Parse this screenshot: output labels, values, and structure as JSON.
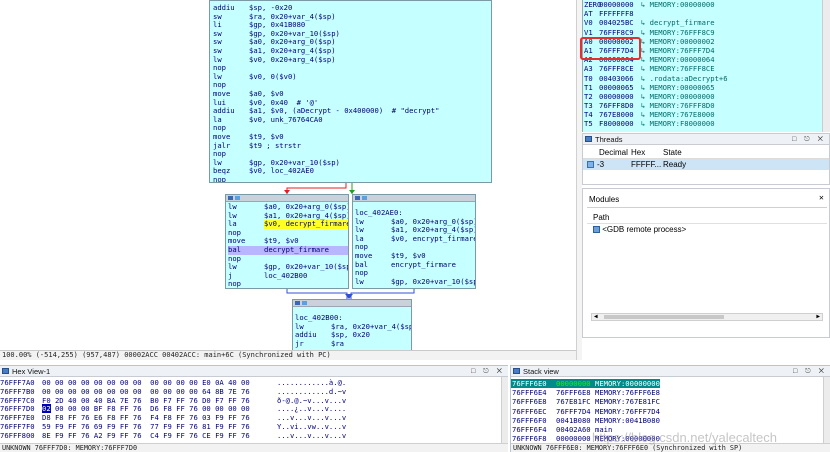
{
  "graph": {
    "top_block": [
      {
        "m": "addiu",
        "o": "$sp, -0x20"
      },
      {
        "m": "sw",
        "o": "$ra, 0x20+var_4($sp)"
      },
      {
        "m": "li",
        "o": "$gp, 0x41B080"
      },
      {
        "m": "sw",
        "o": "$gp, 0x20+var_10($sp)"
      },
      {
        "m": "sw",
        "o": "$a0, 0x20+arg_0($sp)"
      },
      {
        "m": "sw",
        "o": "$a1, 0x20+arg_4($sp)"
      },
      {
        "m": "lw",
        "o": "$v0, 0x20+arg_4($sp)"
      },
      {
        "m": "nop",
        "o": ""
      },
      {
        "m": "lw",
        "o": "$v0, 0($v0)"
      },
      {
        "m": "nop",
        "o": ""
      },
      {
        "m": "move",
        "o": "$a0, $v0"
      },
      {
        "m": "lui",
        "o": "$v0, 0x40  # '@'"
      },
      {
        "m": "addiu",
        "o": "$a1, $v0, (aDecrypt - 0x400000)  # \"decrypt\""
      },
      {
        "m": "la",
        "o": "$v0, unk_76764CA0"
      },
      {
        "m": "nop",
        "o": ""
      },
      {
        "m": "move",
        "o": "$t9, $v0"
      },
      {
        "m": "jalr",
        "o": "$t9 ; strstr"
      },
      {
        "m": "nop",
        "o": ""
      },
      {
        "m": "lw",
        "o": "$gp, 0x20+var_10($sp)"
      },
      {
        "m": "beqz",
        "o": "$v0, loc_402AE0"
      },
      {
        "m": "nop",
        "o": ""
      }
    ],
    "left_block": [
      {
        "m": "lw",
        "o": "$a0, 0x20+arg_0($sp)"
      },
      {
        "m": "lw",
        "o": "$a1, 0x20+arg_4($sp)"
      },
      {
        "m": "la",
        "o": "$v0, decrypt_firmare"
      },
      {
        "m": "nop",
        "o": ""
      },
      {
        "m": "move",
        "o": "$t9, $v0"
      },
      {
        "m": "bal",
        "o": "decrypt_firmare"
      },
      {
        "m": "nop",
        "o": ""
      },
      {
        "m": "lw",
        "o": "$gp, 0x20+var_10($sp)"
      },
      {
        "m": "j",
        "o": "loc_402B00"
      },
      {
        "m": "nop",
        "o": ""
      }
    ],
    "right_label": "loc_402AE0:",
    "right_block": [
      {
        "m": "lw",
        "o": "$a0, 0x20+arg_0($sp)"
      },
      {
        "m": "lw",
        "o": "$a1, 0x20+arg_4($sp)"
      },
      {
        "m": "la",
        "o": "$v0, encrypt_firmare"
      },
      {
        "m": "nop",
        "o": ""
      },
      {
        "m": "move",
        "o": "$t9, $v0"
      },
      {
        "m": "bal",
        "o": "encrypt_firmare"
      },
      {
        "m": "nop",
        "o": ""
      },
      {
        "m": "lw",
        "o": "$gp, 0x20+var_10($sp)"
      }
    ],
    "bottom_label": "loc_402B00:",
    "bottom_block": [
      {
        "m": "lw",
        "o": "$ra, 0x20+var_4($sp)"
      },
      {
        "m": "addiu",
        "o": "$sp, 0x20"
      },
      {
        "m": "jr",
        "o": "$ra"
      },
      {
        "m": "nop",
        "o": ""
      }
    ],
    "coord_status": "100.00% (-514,255) (957,487) 00002ACC 00402ACC: main+6C (Synchronized with PC)"
  },
  "registers": [
    {
      "name": "ZERO",
      "value": "00000000",
      "desc": "MEMORY:00000000"
    },
    {
      "name": "AT",
      "value": "FFFFFFF8",
      "desc": ""
    },
    {
      "name": "V0",
      "value": "004025BC",
      "desc": "decrypt_firmare"
    },
    {
      "name": "V1",
      "value": "76FFF8C9",
      "desc": "MEMORY:76FFF8C9"
    },
    {
      "name": "A0",
      "value": "00000002",
      "desc": "MEMORY:00000002"
    },
    {
      "name": "A1",
      "value": "76FFF7D4",
      "desc": "MEMORY:76FFF7D4"
    },
    {
      "name": "A2",
      "value": "00000064",
      "desc": "MEMORY:00000064"
    },
    {
      "name": "A3",
      "value": "76FFF8CE",
      "desc": "MEMORY:76FFF8CE"
    },
    {
      "name": "T0",
      "value": "00403066",
      "desc": ".rodata:aDecrypt+6"
    },
    {
      "name": "T1",
      "value": "00000065",
      "desc": "MEMORY:00000065"
    },
    {
      "name": "T2",
      "value": "00000000",
      "desc": "MEMORY:00000000"
    },
    {
      "name": "T3",
      "value": "76FFF8D0",
      "desc": "MEMORY:76FFF8D0"
    },
    {
      "name": "T4",
      "value": "767E8000",
      "desc": "MEMORY:767E8000"
    },
    {
      "name": "T5",
      "value": "F8000000",
      "desc": "MEMORY:F8000000"
    }
  ],
  "threads": {
    "title": "Threads",
    "columns": [
      "Decimal",
      "Hex",
      "State"
    ],
    "rows": [
      {
        "decimal": "-3",
        "hex": "FFFFF...",
        "state": "Ready"
      }
    ]
  },
  "modules": {
    "title": "Modules",
    "column": "Path",
    "rows": [
      "<GDB remote process>"
    ]
  },
  "hex_view": {
    "title": "Hex View-1",
    "rows": [
      {
        "addr": "76FFF7A0",
        "bytes": "00 00 00 00 00 00 00 00  00 00 00 00 E0 0A 40 00",
        "ascii": "............à.@."
      },
      {
        "addr": "76FFF7B0",
        "bytes": "00 00 00 00 00 00 00 00  00 00 00 00 64 8B 7E 76",
        "ascii": "............d.~v"
      },
      {
        "addr": "76FFF7C0",
        "bytes": "F0 2D 40 00 40 BA 7E 76  B0 F7 FF 76 D0 F7 FF 76",
        "ascii": "ð-@.@.~v...v...v"
      },
      {
        "addr": "76FFF7D0",
        "bytes": "02 00 00 00 BF F8 FF 76  D6 F8 FF 76 00 00 00 00",
        "ascii": "....¿..v...v...."
      },
      {
        "addr": "76FFF7E0",
        "bytes": "D8 F8 FF 76 E6 F8 FF 76  F4 F8 FF 76 03 F9 FF 76",
        "ascii": "...v...v...v...v"
      },
      {
        "addr": "76FFF7F0",
        "bytes": "59 F9 FF 76 69 F9 FF 76  77 F9 FF 76 81 F9 FF 76",
        "ascii": "Y..vi..vw..v...v"
      },
      {
        "addr": "76FFF800",
        "bytes": "8E F9 FF 76 A2 F9 FF 76  C4 F9 FF 76 CE F9 FF 76",
        "ascii": "...v...v...v...v"
      }
    ],
    "highlight_byte": "02",
    "status": "UNKNOWN 76FFF7D0: MEMORY:76FFF7D0"
  },
  "stack_view": {
    "title": "Stack view",
    "rows": [
      {
        "addr": "76FFF6E0",
        "value": "00000000",
        "desc": "MEMORY:00000000"
      },
      {
        "addr": "76FFF6E4",
        "value": "76FFF6E8",
        "desc": "MEMORY:76FFF6E8"
      },
      {
        "addr": "76FFF6E8",
        "value": "767E81FC",
        "desc": "MEMORY:767E81FC"
      },
      {
        "addr": "76FFF6EC",
        "value": "76FFF7D4",
        "desc": "MEMORY:76FFF7D4"
      },
      {
        "addr": "76FFF6F0",
        "value": "0041B080",
        "desc": "MEMORY:0041B080"
      },
      {
        "addr": "76FFF6F4",
        "value": "00402A60",
        "desc": "main"
      },
      {
        "addr": "76FFF6F8",
        "value": "00000000",
        "desc": "MEMORY:00000000"
      }
    ],
    "status": "UNKNOWN 76FFF6E0: MEMORY:76FFF6E0 (Synchronized with SP)"
  },
  "watermark": "https://blog.csdn.net/yalecaltech",
  "colors": {
    "node_bg": "#c6ffff",
    "highlight": "#b7b6ff",
    "register_box": "#e03030"
  }
}
